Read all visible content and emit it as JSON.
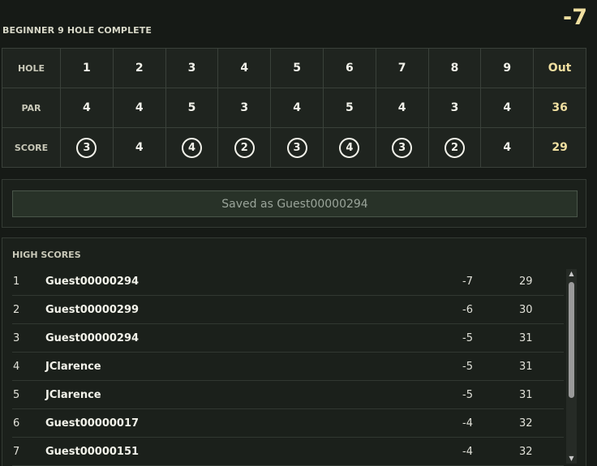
{
  "header": {
    "course_title": "BEGINNER 9 HOLE COMPLETE",
    "total_to_par": "-7"
  },
  "scorecard": {
    "hole_label": "HOLE",
    "par_label": "PAR",
    "score_label": "SCORE",
    "out_label": "Out",
    "holes": [
      "1",
      "2",
      "3",
      "4",
      "5",
      "6",
      "7",
      "8",
      "9"
    ],
    "par": [
      "4",
      "4",
      "5",
      "3",
      "4",
      "5",
      "4",
      "3",
      "4"
    ],
    "par_total": "36",
    "scores": [
      "3",
      "4",
      "4",
      "2",
      "3",
      "4",
      "3",
      "2",
      "4"
    ],
    "score_total": "29"
  },
  "save": {
    "message": "Saved as Guest00000294"
  },
  "high_scores": {
    "title": "HIGH SCORES",
    "rows": [
      {
        "rank": "1",
        "name": "Guest00000294",
        "to_par": "-7",
        "strokes": "29"
      },
      {
        "rank": "2",
        "name": "Guest00000299",
        "to_par": "-6",
        "strokes": "30"
      },
      {
        "rank": "3",
        "name": "Guest00000294",
        "to_par": "-5",
        "strokes": "31"
      },
      {
        "rank": "4",
        "name": "JClarence",
        "to_par": "-5",
        "strokes": "31"
      },
      {
        "rank": "5",
        "name": "JClarence",
        "to_par": "-5",
        "strokes": "31"
      },
      {
        "rank": "6",
        "name": "Guest00000017",
        "to_par": "-4",
        "strokes": "32"
      },
      {
        "rank": "7",
        "name": "Guest00000151",
        "to_par": "-4",
        "strokes": "32"
      }
    ]
  },
  "colors": {
    "background": "#161a16",
    "accent_gold": "#f0dfa0",
    "panel": "#1b201b"
  },
  "icons": {
    "scroll_up": "triangle-up-icon",
    "scroll_down": "triangle-down-icon"
  }
}
